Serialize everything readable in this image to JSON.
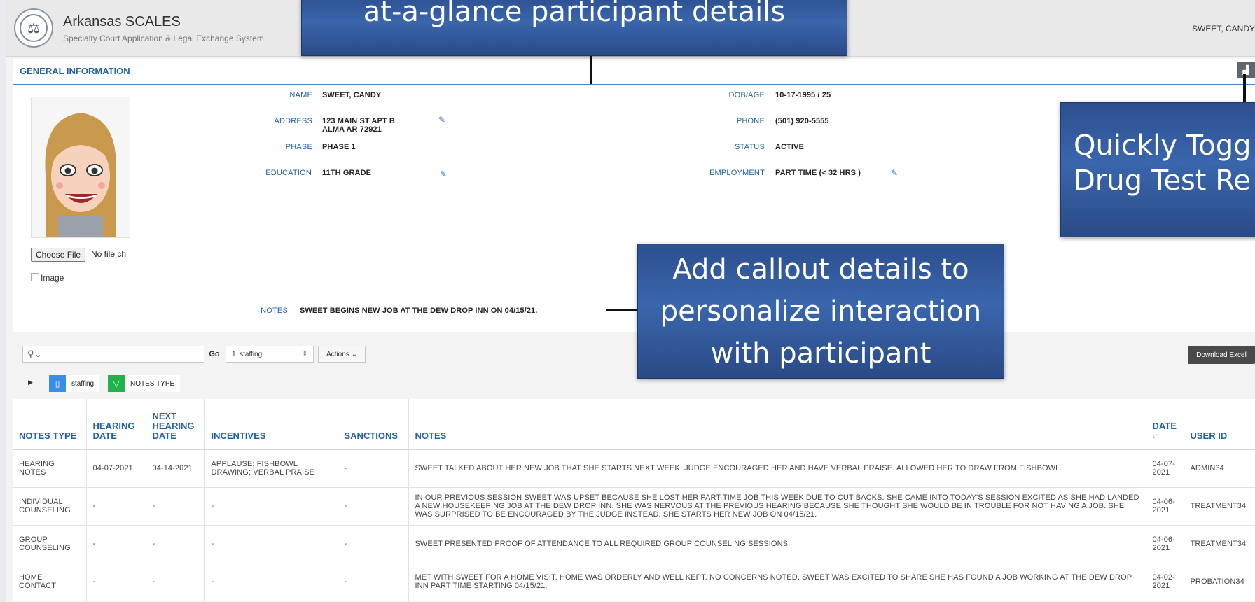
{
  "header": {
    "app_title": "Arkansas SCALES",
    "app_subtitle": "Specialty Court Application & Legal Exchange System",
    "user_name": "SWEET, CANDY"
  },
  "general_info": {
    "section_title": "GENERAL INFORMATION",
    "fields": {
      "name": {
        "label": "NAME",
        "value": "SWEET, CANDY"
      },
      "address": {
        "label": "ADDRESS",
        "line1": "123 MAIN ST APT B",
        "line2": "ALMA AR 72921"
      },
      "phase": {
        "label": "PHASE",
        "value": "PHASE 1"
      },
      "education": {
        "label": "EDUCATION",
        "value": "11TH GRADE"
      },
      "dob_age": {
        "label": "DOB/AGE",
        "value": "10-17-1995 / 25"
      },
      "phone": {
        "label": "PHONE",
        "value": "(501) 920-5555"
      },
      "status": {
        "label": "STATUS",
        "value": "ACTIVE"
      },
      "employment": {
        "label": "EMPLOYMENT",
        "value": "PART TIME (< 32 HRS )"
      }
    },
    "notes": {
      "label": "NOTES",
      "value": "SWEET BEGINS NEW JOB AT THE DEW DROP INN ON 04/15/21."
    },
    "file_button": "Choose File",
    "file_status": "No file ch",
    "image_alt": "Image"
  },
  "toolbar": {
    "go_label": "Go",
    "report_select": "1. staffing",
    "actions_label": "Actions",
    "download_label": "Download Excel"
  },
  "filters": {
    "saved_report": "staffing",
    "filter_label": "NOTES TYPE"
  },
  "table": {
    "headers": [
      "NOTES TYPE",
      "HEARING DATE",
      "NEXT HEARING DATE",
      "INCENTIVES",
      "SANCTIONS",
      "NOTES",
      "DATE",
      "USER ID"
    ],
    "rows": [
      [
        "HEARING NOTES",
        "04-07-2021",
        "04-14-2021",
        "APPLAUSE; FISHBOWL DRAWING; VERBAL PRAISE",
        "-",
        "SWEET TALKED ABOUT HER NEW JOB THAT SHE STARTS NEXT WEEK. JUDGE ENCOURAGED HER AND HAVE VERBAL PRAISE. ALLOWED HER TO DRAW FROM FISHBOWL.",
        "04-07-2021",
        "ADMIN34"
      ],
      [
        "INDIVIDUAL COUNSELING",
        "-",
        "-",
        "-",
        "-",
        "IN OUR PREVIOUS SESSION SWEET WAS UPSET BECAUSE SHE LOST HER PART TIME JOB THIS WEEK DUE TO CUT BACKS. SHE CAME INTO TODAY'S SESSION EXCITED AS SHE HAD LANDED A NEW HOUSEKEEPING JOB AT THE DEW DROP INN. SHE WAS NERVOUS AT THE PREVIOUS HEARING BECAUSE SHE THOUGHT SHE WOULD BE IN TROUBLE FOR NOT HAVING A JOB. SHE WAS SURPRISED TO BE ENCOURAGED BY THE JUDGE INSTEAD. SHE STARTS HER NEW JOB ON 04/15/21.",
        "04-06-2021",
        "TREATMENT34"
      ],
      [
        "GROUP COUNSELING",
        "-",
        "-",
        "-",
        "-",
        "SWEET PRESENTED PROOF OF ATTENDANCE TO ALL REQUIRED GROUP COUNSELING SESSIONS.",
        "04-06-2021",
        "TREATMENT34"
      ],
      [
        "HOME CONTACT",
        "-",
        "-",
        "-",
        "-",
        "MET WITH SWEET FOR A HOME VISIT. HOME WAS ORDERLY AND WELL KEPT. NO CONCERNS NOTED. SWEET WAS EXCITED TO SHARE SHE HAS FOUND A JOB WORKING AT THE DEW DROP INN PART TIME STARTING 04/15/21.",
        "04-02-2021",
        "PROBATION34"
      ]
    ]
  },
  "callouts": {
    "top": "at-a-glance participant details",
    "right_line1": "Quickly Togg",
    "right_line2": "Drug Test Re",
    "middle_line1": "Add callout details to",
    "middle_line2": "personalize interaction",
    "middle_line3": "with participant"
  }
}
